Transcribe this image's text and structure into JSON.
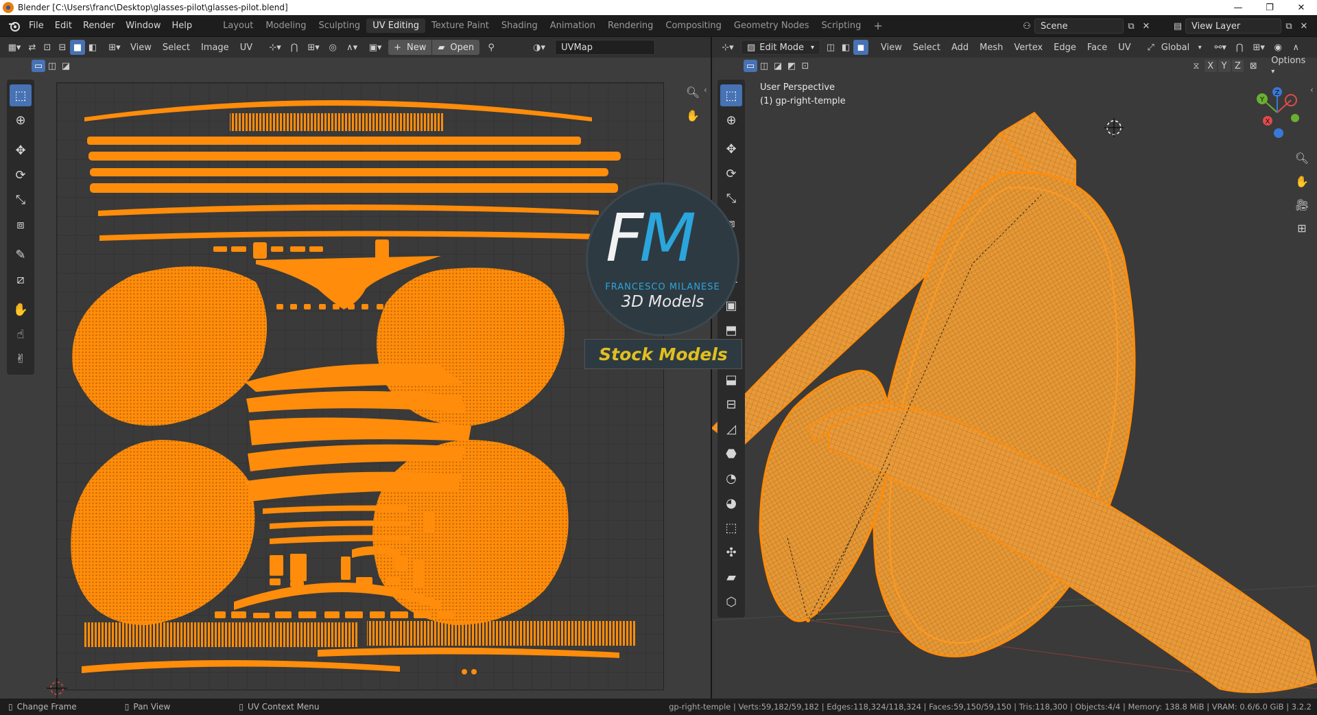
{
  "window": {
    "title": "Blender [C:\\Users\\franc\\Desktop\\glasses-pilot\\glasses-pilot.blend]",
    "minimize": "—",
    "maximize": "❐",
    "close": "✕"
  },
  "menu": [
    "File",
    "Edit",
    "Render",
    "Window",
    "Help"
  ],
  "workspaces": [
    "Layout",
    "Modeling",
    "Sculpting",
    "UV Editing",
    "Texture Paint",
    "Shading",
    "Animation",
    "Rendering",
    "Compositing",
    "Geometry Nodes",
    "Scripting"
  ],
  "active_workspace": "UV Editing",
  "add_workspace": "+",
  "scene": {
    "label": "Scene"
  },
  "view_layer": {
    "label": "View Layer"
  },
  "uv_editor": {
    "menus": [
      "View",
      "Select",
      "Image",
      "UV"
    ],
    "new_label": "New",
    "open_label": "Open",
    "uvmap": "UVMap"
  },
  "viewport": {
    "mode": "Edit Mode",
    "menus": [
      "View",
      "Select",
      "Add",
      "Mesh",
      "Vertex",
      "Edge",
      "Face",
      "UV"
    ],
    "orientation": "Global",
    "axes": [
      "X",
      "Y",
      "Z"
    ],
    "options_label": "Options",
    "perspective": "User Perspective",
    "object": "(1) gp-right-temple",
    "gizmo": {
      "x": "X",
      "y": "Y",
      "z": "Z"
    }
  },
  "watermark": {
    "initials_f": "F",
    "initials_m": "M",
    "name": "FRANCESCO MILANESE",
    "subtitle": "3D Models",
    "banner": "Stock Models"
  },
  "status": {
    "left": [
      "Change Frame",
      "Pan View",
      "UV Context Menu"
    ],
    "right": "gp-right-temple | Verts:59,182/59,182 | Edges:118,324/118,324 | Faces:59,150/59,150 | Tris:118,300 | Objects:4/4 | Memory: 138.8 MiB | VRAM: 0.6/6.0 GiB | 3.2.2"
  },
  "colors": {
    "accent": "#4772b3",
    "mesh": "#ff8c0a",
    "uv_bg": "#3d3d3d",
    "viewport_bg": "#3a3a3a"
  }
}
